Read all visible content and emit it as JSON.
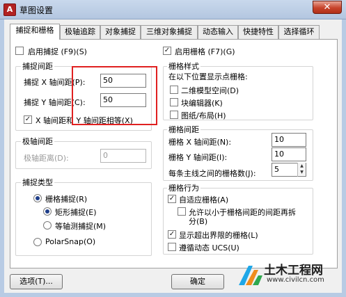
{
  "window": {
    "title": "草图设置",
    "close_glyph": "✕",
    "app_icon_glyph": "A"
  },
  "tabs": [
    {
      "label": "捕捉和栅格",
      "active": true
    },
    {
      "label": "极轴追踪",
      "active": false
    },
    {
      "label": "对象捕捉",
      "active": false
    },
    {
      "label": "三维对象捕捉",
      "active": false
    },
    {
      "label": "动态输入",
      "active": false
    },
    {
      "label": "快捷特性",
      "active": false
    },
    {
      "label": "选择循环",
      "active": false
    }
  ],
  "snap": {
    "enable_label": "启用捕捉 (F9)(S)",
    "enabled": false,
    "spacing_group": "捕捉间距",
    "x_label": "捕捉 X 轴间距(P):",
    "x_value": "50",
    "y_label": "捕捉 Y 轴间距(C):",
    "y_value": "50",
    "equal_label": "X 轴间距和 Y 轴间距相等(X)",
    "equal_checked": true
  },
  "polar": {
    "group": "极轴间距",
    "distance_label": "极轴距离(D):",
    "distance_value": "0"
  },
  "snap_type": {
    "group": "捕捉类型",
    "grid_snap_label": "栅格捕捉(R)",
    "rect_snap_label": "矩形捕捉(E)",
    "iso_snap_label": "等轴测捕捉(M)",
    "polar_snap_label": "PolarSnap(O)"
  },
  "grid": {
    "enable_label": "启用栅格 (F7)(G)",
    "enabled": true,
    "style_group": "栅格样式",
    "style_hint": "在以下位置显示点栅格:",
    "style_2d_label": "二维模型空间(D)",
    "style_block_label": "块编辑器(K)",
    "style_sheet_label": "图纸/布局(H)",
    "spacing_group": "栅格间距",
    "x_label": "栅格 X 轴间距(N):",
    "x_value": "10",
    "y_label": "栅格 Y 轴间距(I):",
    "y_value": "10",
    "major_label": "每条主线之间的栅格数(J):",
    "major_value": "5",
    "behavior_group": "栅格行为",
    "adaptive_label": "自适应栅格(A)",
    "subdivide_label_1": "允许以小于栅格间距的间距再拆",
    "subdivide_label_2": "分(B)",
    "beyond_label": "显示超出界限的栅格(L)",
    "follow_ucs_label": "遵循动态 UCS(U)"
  },
  "buttons": {
    "options": "选项(T)...",
    "ok": "确定"
  },
  "watermark": {
    "name": "土木工程网",
    "url": "www.civilcn.com"
  },
  "colors": {
    "highlight_box": "#e02020",
    "titlebar": "#c9d8ec"
  }
}
